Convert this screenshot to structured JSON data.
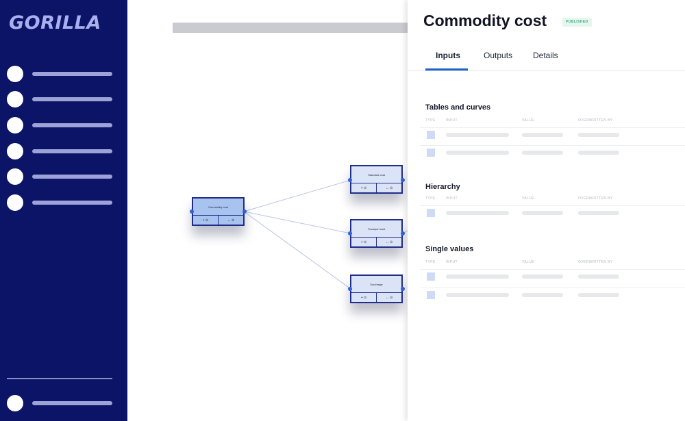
{
  "sidebar": {
    "logo_text": "GORILLA",
    "nav_items": [
      {
        "icon": "circle-icon"
      },
      {
        "icon": "circle-icon"
      },
      {
        "icon": "circle-icon"
      },
      {
        "icon": "circle-icon"
      },
      {
        "icon": "circle-icon"
      },
      {
        "icon": "circle-icon"
      }
    ],
    "footer_item": {
      "icon": "circle-icon"
    }
  },
  "canvas": {
    "nodes": [
      {
        "title": "Commodity cost",
        "left_action": "+ ⊙",
        "right_action": "↔ ⊙"
      },
      {
        "title": "Standard cost",
        "left_action": "+ ⊙",
        "right_action": "↔ ⊙"
      },
      {
        "title": "Transport cost",
        "left_action": "+ ⊙",
        "right_action": "↔ ⊙"
      },
      {
        "title": "Surcharge",
        "left_action": "+ ⊙",
        "right_action": "↔ ⊙"
      }
    ]
  },
  "panel": {
    "title": "Commodity cost",
    "status_badge": "PUBLISHED",
    "tabs": [
      {
        "label": "Inputs",
        "active": true
      },
      {
        "label": "Outputs",
        "active": false
      },
      {
        "label": "Details",
        "active": false
      }
    ],
    "columns": [
      "TYPE",
      "INPUT",
      "VALUE",
      "OVERWRITTEN BY"
    ],
    "sections": [
      {
        "title": "Tables and curves",
        "rows": 2
      },
      {
        "title": "Hierarchy",
        "rows": 1
      },
      {
        "title": "Single values",
        "rows": 2
      }
    ]
  },
  "colors": {
    "sidebar_bg": "#0c1468",
    "accent": "#1c62c4",
    "badge_text": "#3fae8a",
    "node_border": "#1f2c8a"
  }
}
